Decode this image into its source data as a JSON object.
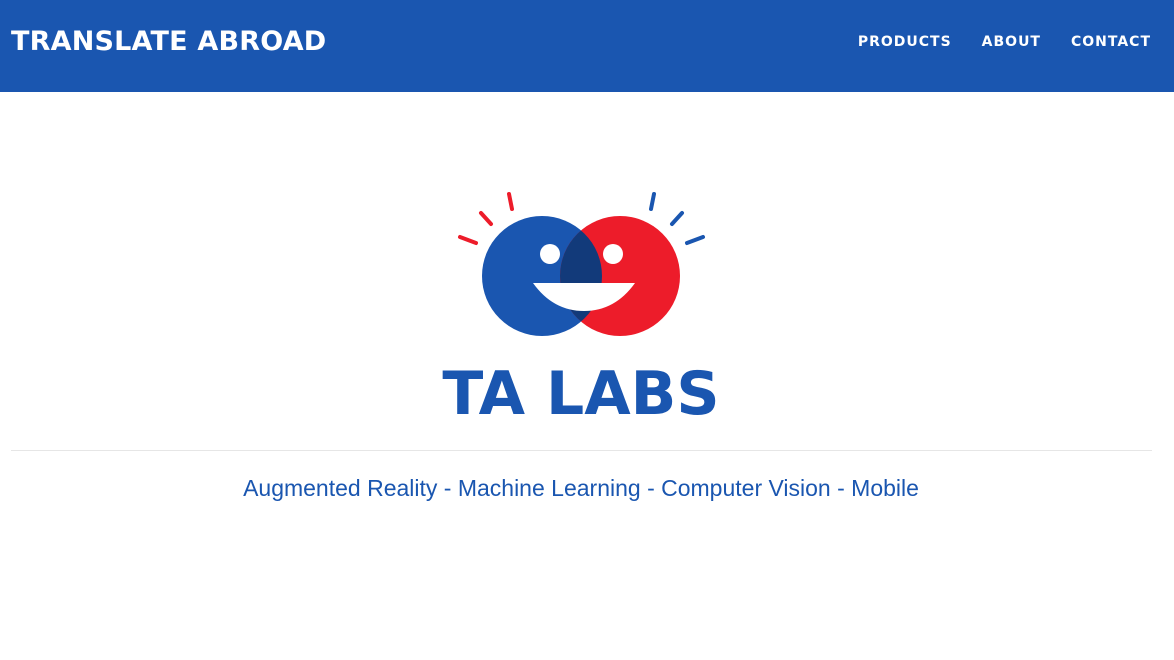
{
  "header": {
    "brand": "TRANSLATE ABROAD",
    "nav": [
      {
        "label": "PRODUCTS"
      },
      {
        "label": "ABOUT"
      },
      {
        "label": "CONTACT"
      }
    ]
  },
  "hero": {
    "logo_text": "TA LABS",
    "tagline": "Augmented Reality - Machine Learning - Computer Vision - Mobile"
  },
  "colors": {
    "brand_blue": "#1a56b0",
    "accent_red": "#ed1c2a",
    "overlap_navy": "#123a7a",
    "background": "#ffffff"
  }
}
